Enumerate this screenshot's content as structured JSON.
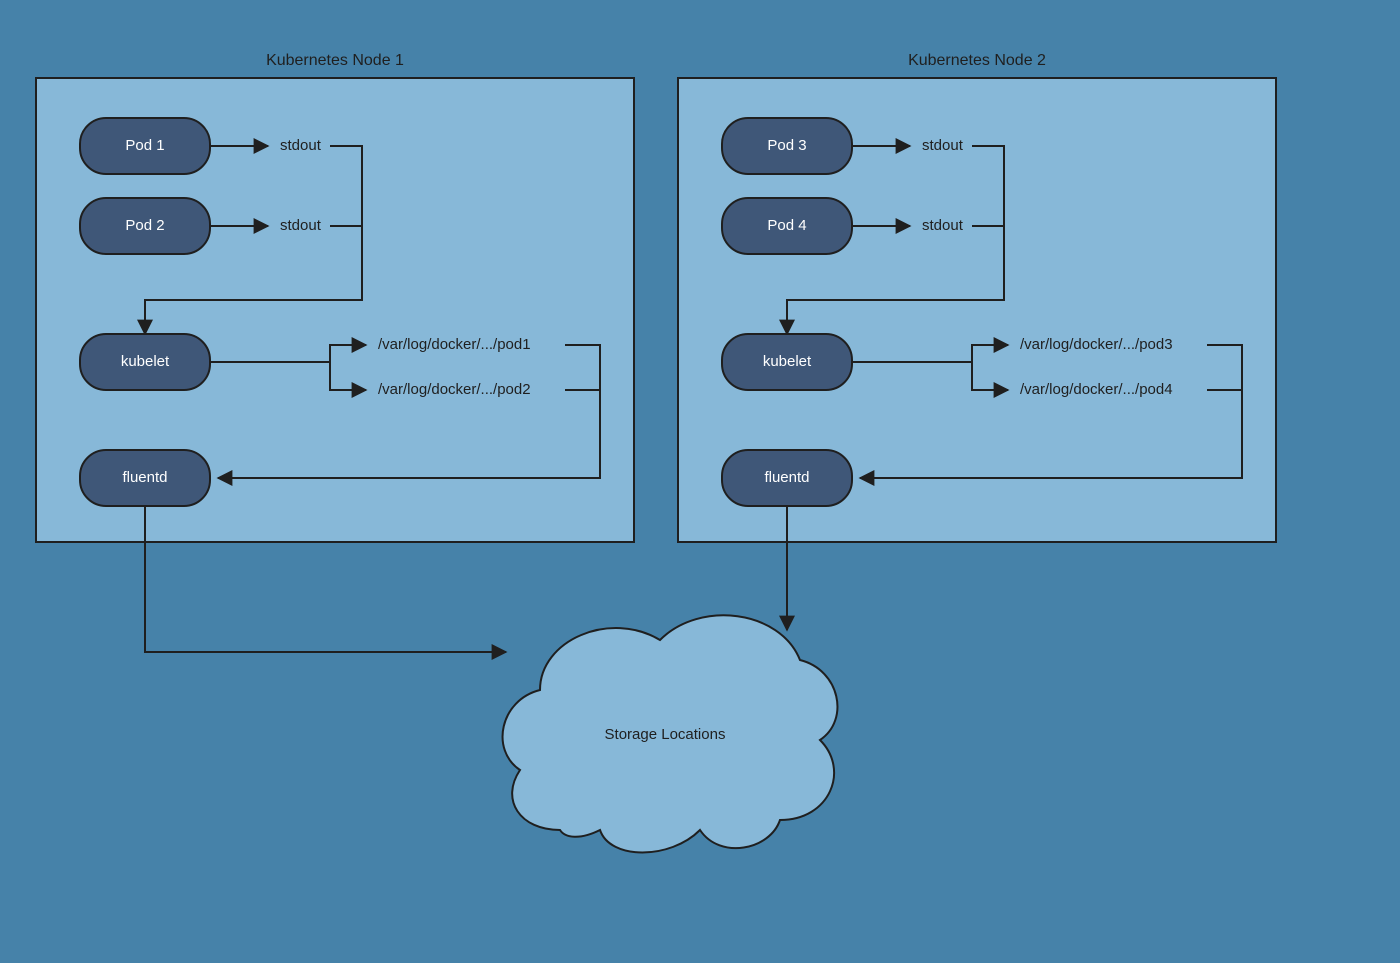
{
  "nodes": [
    {
      "title": "Kubernetes Node 1",
      "pods": [
        "Pod 1",
        "Pod 2"
      ],
      "stdout": [
        "stdout",
        "stdout"
      ],
      "kubelet": "kubelet",
      "logpaths": [
        "/var/log/docker/.../pod1",
        "/var/log/docker/.../pod2"
      ],
      "fluentd": "fluentd"
    },
    {
      "title": "Kubernetes Node 2",
      "pods": [
        "Pod 3",
        "Pod 4"
      ],
      "stdout": [
        "stdout",
        "stdout"
      ],
      "kubelet": "kubelet",
      "logpaths": [
        "/var/log/docker/.../pod3",
        "/var/log/docker/.../pod4"
      ],
      "fluentd": "fluentd"
    }
  ],
  "storage": "Storage Locations"
}
